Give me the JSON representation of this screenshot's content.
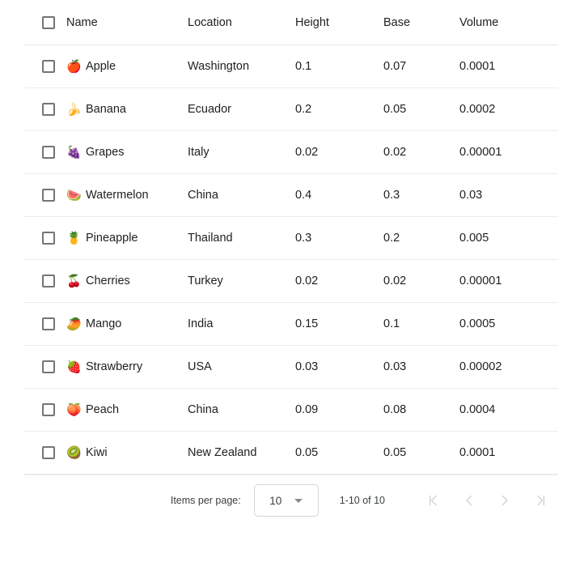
{
  "table": {
    "columns": [
      {
        "key": "select",
        "label": ""
      },
      {
        "key": "name",
        "label": "Name"
      },
      {
        "key": "location",
        "label": "Location"
      },
      {
        "key": "height",
        "label": "Height"
      },
      {
        "key": "base",
        "label": "Base"
      },
      {
        "key": "volume",
        "label": "Volume"
      }
    ],
    "rows": [
      {
        "emoji": "🍎",
        "emoji_name": "apple-icon",
        "name": "Apple",
        "location": "Washington",
        "height": "0.1",
        "base": "0.07",
        "volume": "0.0001"
      },
      {
        "emoji": "🍌",
        "emoji_name": "banana-icon",
        "name": "Banana",
        "location": "Ecuador",
        "height": "0.2",
        "base": "0.05",
        "volume": "0.0002"
      },
      {
        "emoji": "🍇",
        "emoji_name": "grapes-icon",
        "name": "Grapes",
        "location": "Italy",
        "height": "0.02",
        "base": "0.02",
        "volume": "0.00001"
      },
      {
        "emoji": "🍉",
        "emoji_name": "watermelon-icon",
        "name": "Watermelon",
        "location": "China",
        "height": "0.4",
        "base": "0.3",
        "volume": "0.03"
      },
      {
        "emoji": "🍍",
        "emoji_name": "pineapple-icon",
        "name": "Pineapple",
        "location": "Thailand",
        "height": "0.3",
        "base": "0.2",
        "volume": "0.005"
      },
      {
        "emoji": "🍒",
        "emoji_name": "cherries-icon",
        "name": "Cherries",
        "location": "Turkey",
        "height": "0.02",
        "base": "0.02",
        "volume": "0.00001"
      },
      {
        "emoji": "🥭",
        "emoji_name": "mango-icon",
        "name": "Mango",
        "location": "India",
        "height": "0.15",
        "base": "0.1",
        "volume": "0.0005"
      },
      {
        "emoji": "🍓",
        "emoji_name": "strawberry-icon",
        "name": "Strawberry",
        "location": "USA",
        "height": "0.03",
        "base": "0.03",
        "volume": "0.00002"
      },
      {
        "emoji": "🍑",
        "emoji_name": "peach-icon",
        "name": "Peach",
        "location": "China",
        "height": "0.09",
        "base": "0.08",
        "volume": "0.0004"
      },
      {
        "emoji": "🥝",
        "emoji_name": "kiwi-icon",
        "name": "Kiwi",
        "location": "New Zealand",
        "height": "0.05",
        "base": "0.05",
        "volume": "0.0001"
      }
    ]
  },
  "paginator": {
    "items_per_page_label": "Items per page:",
    "page_size_value": "10",
    "page_size_options": [
      "10"
    ],
    "range_label": "1-10 of 10",
    "first_page_label": "First page",
    "previous_page_label": "Previous page",
    "next_page_label": "Next page",
    "last_page_label": "Last page"
  },
  "colors": {
    "text": "#212121",
    "muted": "#3c4043",
    "divider": "#ececec",
    "checkbox_border": "#757575",
    "disabled_arrow": "#d2d2d2"
  }
}
